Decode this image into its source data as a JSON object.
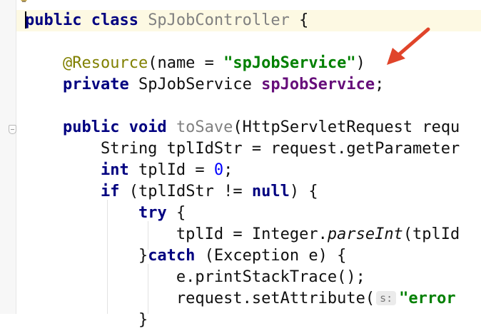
{
  "editor": {
    "lines": [
      {
        "name": "code-line-class-decl",
        "tokens": [
          {
            "t": "public class ",
            "c": "kw"
          },
          {
            "t": "SpJobController",
            "c": "method-unused"
          },
          {
            "t": " {",
            "c": ""
          }
        ]
      },
      {
        "name": "code-line-blank-1",
        "tokens": []
      },
      {
        "name": "code-line-resource-annotation",
        "tokens": [
          {
            "t": "    ",
            "c": ""
          },
          {
            "t": "@Resource",
            "c": "ann"
          },
          {
            "t": "(name = ",
            "c": ""
          },
          {
            "t": "\"spJobService\"",
            "c": "str"
          },
          {
            "t": ")",
            "c": ""
          }
        ]
      },
      {
        "name": "code-line-field-decl",
        "tokens": [
          {
            "t": "    ",
            "c": ""
          },
          {
            "t": "private ",
            "c": "kw"
          },
          {
            "t": "SpJobService ",
            "c": ""
          },
          {
            "t": "spJobService",
            "c": "field"
          },
          {
            "t": ";",
            "c": ""
          }
        ]
      },
      {
        "name": "code-line-blank-2",
        "tokens": []
      },
      {
        "name": "code-line-method-decl",
        "tokens": [
          {
            "t": "    ",
            "c": ""
          },
          {
            "t": "public void ",
            "c": "kw"
          },
          {
            "t": "toSave",
            "c": "method-unused"
          },
          {
            "t": "(HttpServletRequest requ",
            "c": ""
          }
        ]
      },
      {
        "name": "code-line-tplidstr",
        "tokens": [
          {
            "t": "        String tplIdStr = request.getParameter",
            "c": ""
          }
        ]
      },
      {
        "name": "code-line-tplid-init",
        "tokens": [
          {
            "t": "        ",
            "c": ""
          },
          {
            "t": "int ",
            "c": "kw"
          },
          {
            "t": "tplId = ",
            "c": ""
          },
          {
            "t": "0",
            "c": "num"
          },
          {
            "t": ";",
            "c": ""
          }
        ]
      },
      {
        "name": "code-line-if",
        "tokens": [
          {
            "t": "        ",
            "c": ""
          },
          {
            "t": "if ",
            "c": "kw"
          },
          {
            "t": "(tplIdStr != ",
            "c": ""
          },
          {
            "t": "null",
            "c": "kw"
          },
          {
            "t": ") {",
            "c": ""
          }
        ]
      },
      {
        "name": "code-line-try",
        "tokens": [
          {
            "t": "            ",
            "c": ""
          },
          {
            "t": "try ",
            "c": "kw"
          },
          {
            "t": "{",
            "c": ""
          }
        ]
      },
      {
        "name": "code-line-parse",
        "tokens": [
          {
            "t": "                tplId = Integer.",
            "c": ""
          },
          {
            "t": "parseInt",
            "c": "ital"
          },
          {
            "t": "(tplId",
            "c": ""
          }
        ]
      },
      {
        "name": "code-line-catch",
        "tokens": [
          {
            "t": "            }",
            "c": ""
          },
          {
            "t": "catch ",
            "c": "kw"
          },
          {
            "t": "(Exception e) {",
            "c": ""
          }
        ]
      },
      {
        "name": "code-line-printstack",
        "tokens": [
          {
            "t": "                e.printStackTrace();",
            "c": ""
          }
        ]
      },
      {
        "name": "code-line-setattribute",
        "tokens": [
          {
            "t": "                request.setAttribute(",
            "c": ""
          },
          {
            "t": "s:",
            "c": "hint"
          },
          {
            "t": "\"error",
            "c": "str"
          }
        ]
      },
      {
        "name": "code-line-closing",
        "tokens": [
          {
            "t": "            }",
            "c": ""
          }
        ]
      }
    ]
  },
  "colors": {
    "keyword": "#000080",
    "annotation": "#808000",
    "string": "#008000",
    "field": "#660e7a",
    "number": "#0000ff",
    "arrow": "#e0442a",
    "caret_line": "#fdf9e3"
  },
  "icons": {
    "gutter_top": "lightbulb-icon",
    "gutter_fold": "fold-icon",
    "annotation_pointer": "red-arrow-icon"
  }
}
